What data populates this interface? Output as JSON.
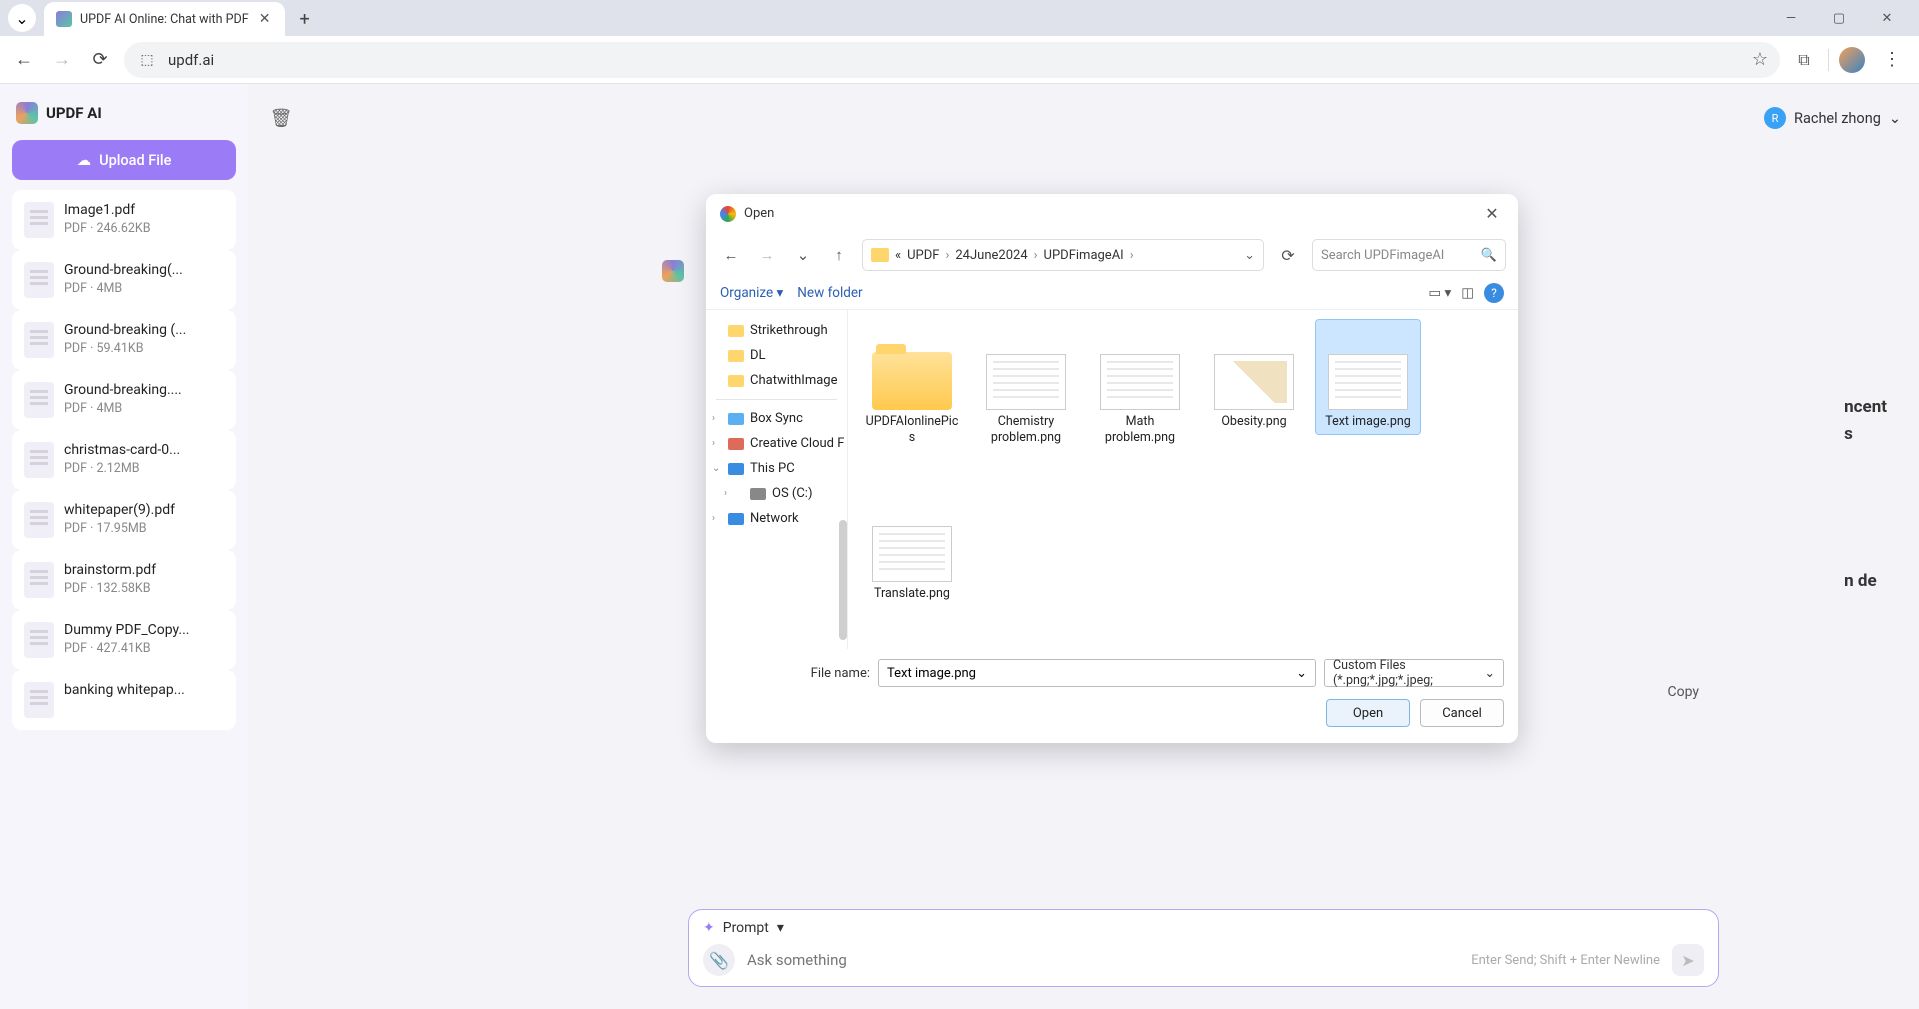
{
  "browser": {
    "tab_title": "UPDF AI Online: Chat with PDF",
    "url": "updf.ai",
    "window_controls": {
      "min": "—",
      "max": "▢",
      "close": "✕"
    }
  },
  "app": {
    "brand": "UPDF AI",
    "upload_label": "Upload File",
    "user_name": "Rachel zhong",
    "user_initial": "R"
  },
  "sidebar_files": [
    {
      "name": "Image1.pdf",
      "meta": "PDF · 246.62KB"
    },
    {
      "name": "Ground-breaking(...",
      "meta": "PDF · 4MB"
    },
    {
      "name": "Ground-breaking (...",
      "meta": "PDF · 59.41KB"
    },
    {
      "name": "Ground-breaking....",
      "meta": "PDF · 4MB"
    },
    {
      "name": "christmas-card-0...",
      "meta": "PDF · 2.12MB"
    },
    {
      "name": "whitepaper(9).pdf",
      "meta": "PDF · 17.95MB"
    },
    {
      "name": "brainstorm.pdf",
      "meta": "PDF · 132.58KB"
    },
    {
      "name": "Dummy PDF_Copy...",
      "meta": "PDF · 427.41KB"
    },
    {
      "name": "banking whitepap...",
      "meta": ""
    }
  ],
  "bg_fragments": {
    "line1a": "ncent",
    "line1b": "s",
    "line2": "n de",
    "copy": "Copy"
  },
  "prompt": {
    "label": "Prompt",
    "placeholder": "Ask something",
    "hint": "Enter Send; Shift + Enter Newline"
  },
  "dialog": {
    "title": "Open",
    "breadcrumb": {
      "prefix": "«",
      "parts": [
        "UPDF",
        "24June2024",
        "UPDFimageAI"
      ]
    },
    "search_placeholder": "Search UPDFimageAI",
    "organize": "Organize",
    "new_folder": "New folder",
    "tree": {
      "strikethrough": "Strikethrough",
      "dl": "DL",
      "chatwithimage": "ChatwithImage",
      "box": "Box Sync",
      "cc": "Creative Cloud F",
      "pc": "This PC",
      "os": "OS (C:)",
      "network": "Network"
    },
    "files": [
      {
        "type": "folder",
        "label": "UPDFAIonlinePics"
      },
      {
        "type": "img",
        "label": "Chemistry problem.png"
      },
      {
        "type": "img",
        "label": "Math problem.png"
      },
      {
        "type": "chart",
        "label": "Obesity.png"
      },
      {
        "type": "img",
        "label": "Text image.png",
        "selected": true
      },
      {
        "type": "img",
        "label": "Translate.png"
      }
    ],
    "filename_label": "File name:",
    "filename_value": "Text image.png",
    "filetype": "Custom Files (*.png;*.jpg;*.jpeg;",
    "open_btn": "Open",
    "cancel_btn": "Cancel"
  }
}
